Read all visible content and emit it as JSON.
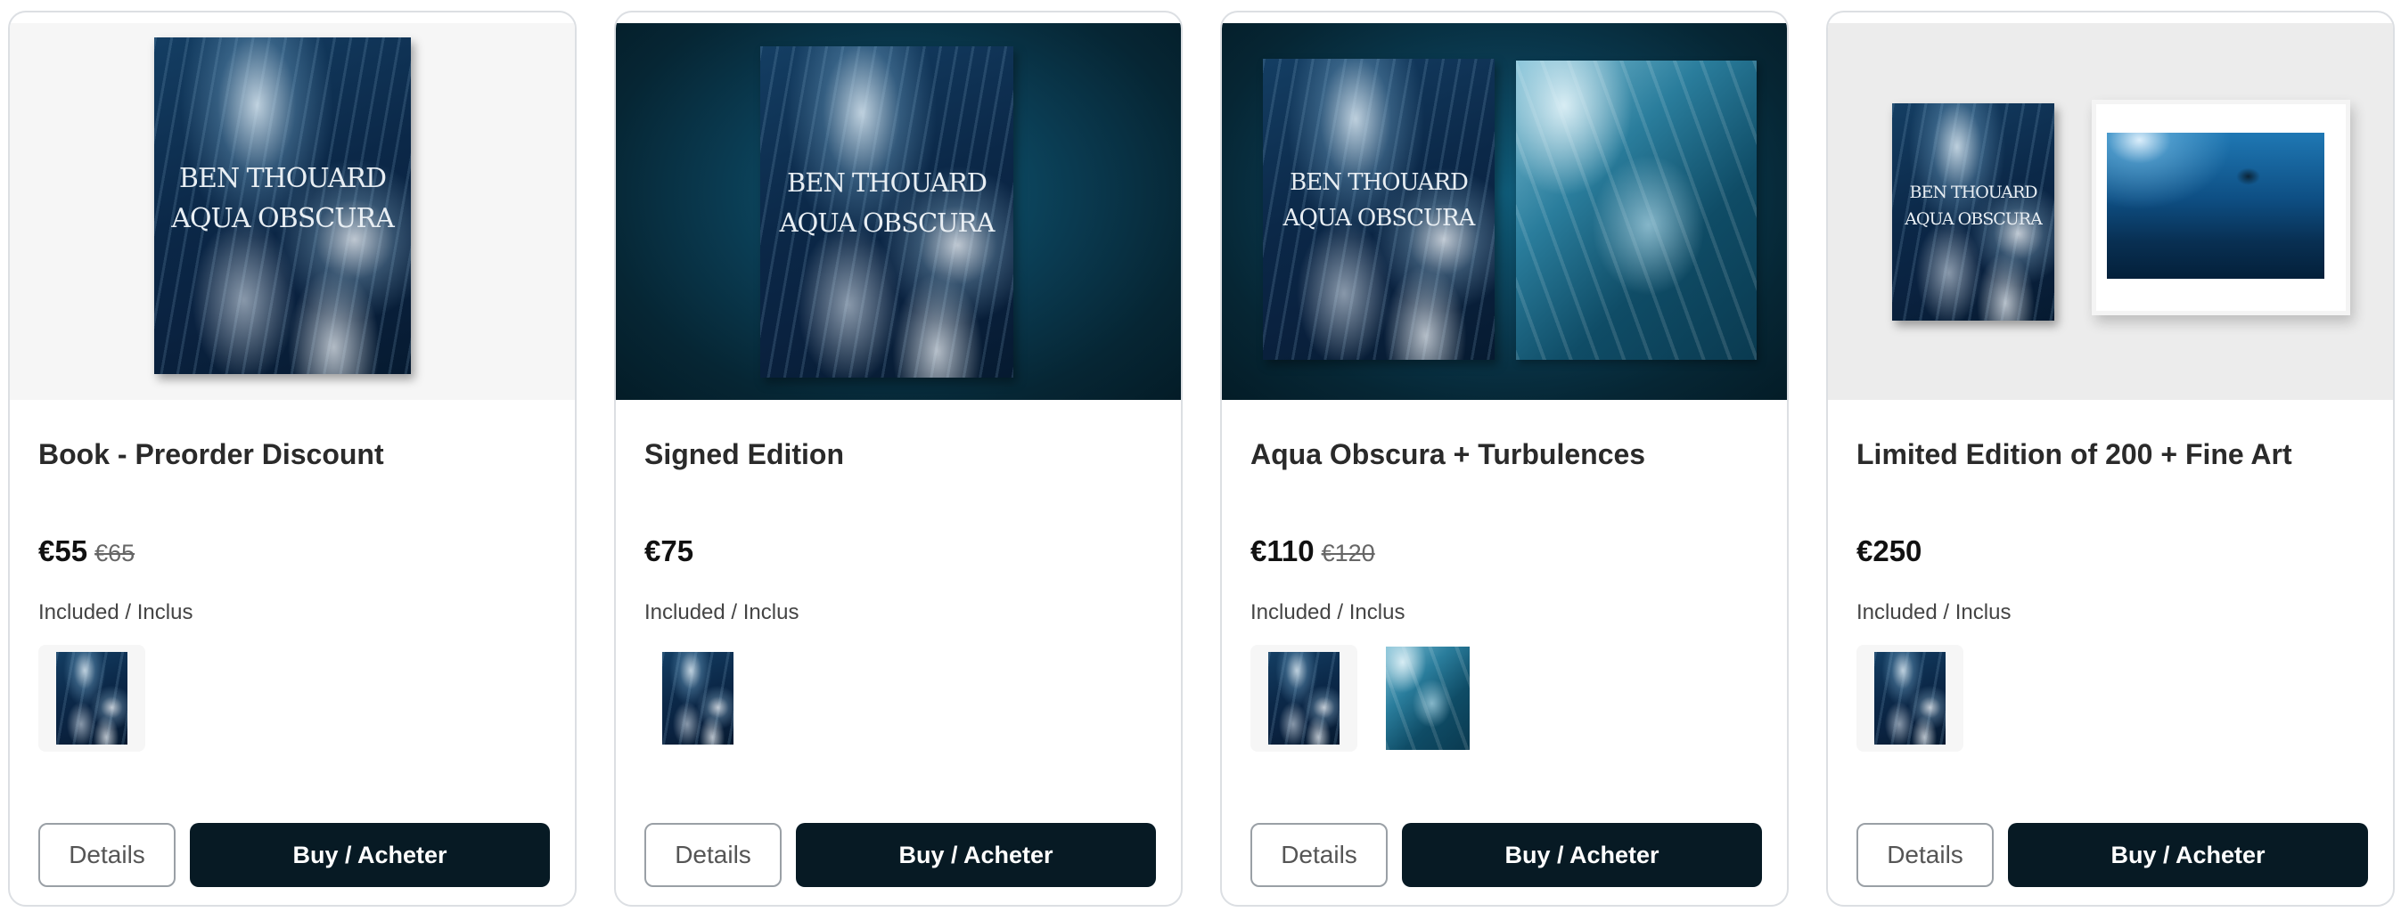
{
  "products": [
    {
      "title": "Book - Preorder Discount",
      "price": "€55",
      "old_price": "€65",
      "included_label": "Included / Inclus",
      "details_label": "Details",
      "buy_label": "Buy / Acheter"
    },
    {
      "title": "Signed Edition",
      "price": "€75",
      "included_label": "Included / Inclus",
      "details_label": "Details",
      "buy_label": "Buy / Acheter"
    },
    {
      "title": "Aqua Obscura + Turbulences",
      "price": "€110",
      "old_price": "€120",
      "included_label": "Included / Inclus",
      "details_label": "Details",
      "buy_label": "Buy / Acheter"
    },
    {
      "title": "Limited Edition of 200 + Fine Art",
      "price": "€250",
      "included_label": "Included / Inclus",
      "details_label": "Details",
      "buy_label": "Buy / Acheter"
    }
  ],
  "book_cover": {
    "author": "BEN THOUARD",
    "title": "AQUA OBSCURA"
  },
  "colors": {
    "buy_button": "#071a24",
    "card_border": "#dcdfe3",
    "hero_dark": "#0a3a50"
  }
}
